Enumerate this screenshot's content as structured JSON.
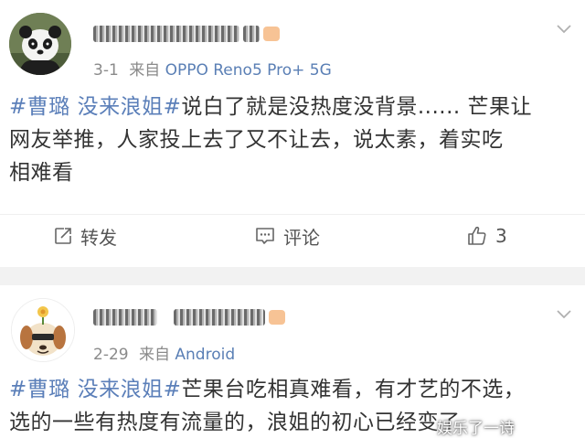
{
  "posts": [
    {
      "meta": {
        "date": "3-1",
        "via": "来自",
        "device": "OPPO Reno5 Pro+ 5G"
      },
      "content": {
        "lines": [
          {
            "tags": [
              "#曹璐",
              "没来浪姐#"
            ],
            "text": "说白了就是没热度没背景...... 芒果让"
          },
          {
            "text": "网友举推，人家投上去了又不让去，说太素，着实吃"
          },
          {
            "text": "相难看"
          }
        ]
      },
      "actions": {
        "repost": "转发",
        "comment": "评论",
        "like_count": "3"
      }
    },
    {
      "meta": {
        "date": "2-29",
        "via": "来自",
        "device": "Android"
      },
      "content": {
        "lines": [
          {
            "tags": [
              "#曹璐",
              "没来浪姐#"
            ],
            "text": "芒果台吃相真难看，有才艺的不选，"
          },
          {
            "text": "选的一些有热度有流量的，浪姐的初心已经变了"
          }
        ]
      }
    }
  ],
  "watermark": "娱乐了一诗",
  "colors": {
    "tag": "#5b7fb9",
    "device": "#5a7fb5",
    "separator": "#f2f2f2"
  },
  "icons": [
    "panda-avatar-icon",
    "dog-avatar-icon",
    "chevron-down-icon",
    "repost-icon",
    "comment-icon",
    "like-icon"
  ]
}
